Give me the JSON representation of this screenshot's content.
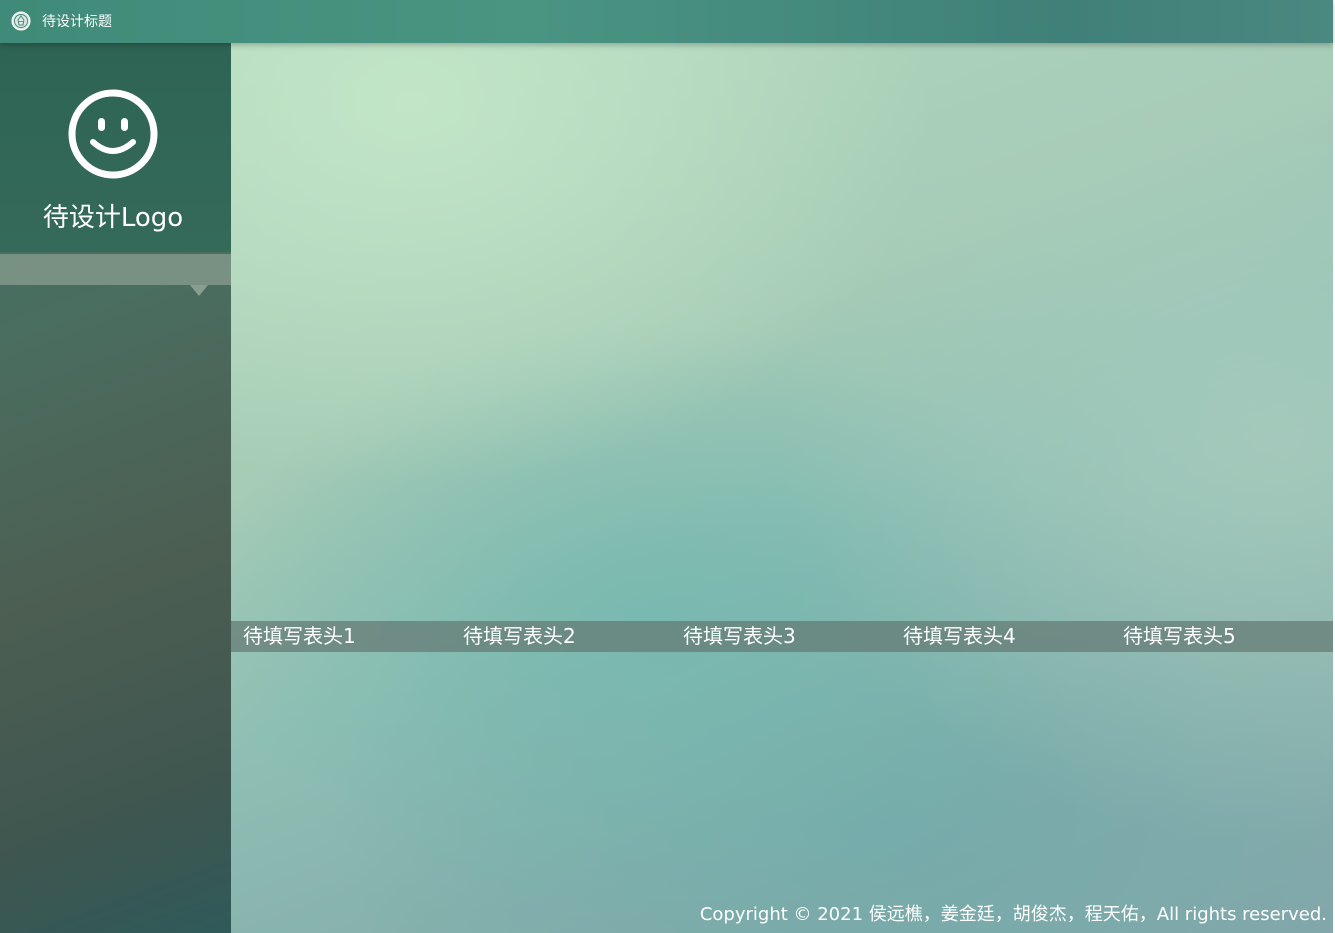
{
  "window": {
    "title": "待设计标题",
    "icon": "emblem-icon"
  },
  "sidebar": {
    "logo_icon": "smiley-face-icon",
    "logo_text": "待设计Logo",
    "menu_caret_icon": "caret-down-icon"
  },
  "main": {
    "table_headers": [
      "待填写表头1",
      "待填写表头2",
      "待填写表头3",
      "待填写表头4",
      "待填写表头5"
    ]
  },
  "footer": {
    "copyright": "Copyright © 2021 侯远樵，姜金廷，胡俊杰，程天佑，All rights reserved."
  },
  "colors": {
    "titlebar": "#3f8a78",
    "logo_box": "#2e6454",
    "text": "#ffffff"
  }
}
